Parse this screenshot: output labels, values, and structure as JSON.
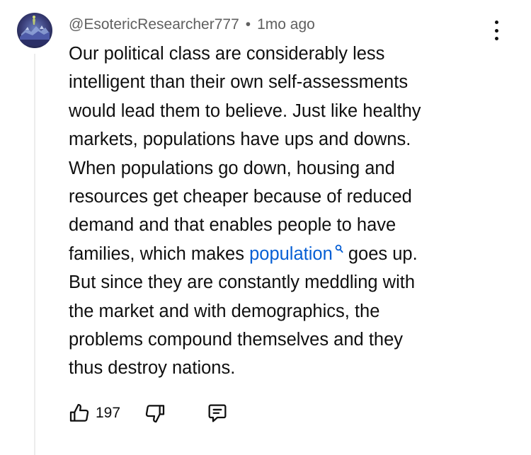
{
  "comment": {
    "author": "@EsotericResearcher777",
    "separator": "•",
    "timestamp": "1mo ago",
    "text_lines": [
      "Our political class are considerably less",
      "intelligent than their own self-assessments",
      "would lead them to believe.  Just like healthy",
      "markets, populations have ups and downs.",
      "When populations go down, housing and",
      "resources get cheaper because of reduced",
      "demand and that enables people to have"
    ],
    "line8_before": "families, which makes ",
    "search_link": "population",
    "line8_after": " goes up.",
    "text_lines_end": [
      "But since they are constantly meddling with",
      "the market and with demographics, the",
      "problems compound themselves and they",
      "thus destroy nations."
    ]
  },
  "actions": {
    "like_count": "197",
    "like_icon": "thumbs-up-icon",
    "dislike_icon": "thumbs-down-icon",
    "reply_icon": "comment-icon",
    "more_icon": "more-vertical-icon"
  },
  "colors": {
    "link": "#065fd4",
    "meta_text": "#606060",
    "body_text": "#0f0f0f"
  }
}
